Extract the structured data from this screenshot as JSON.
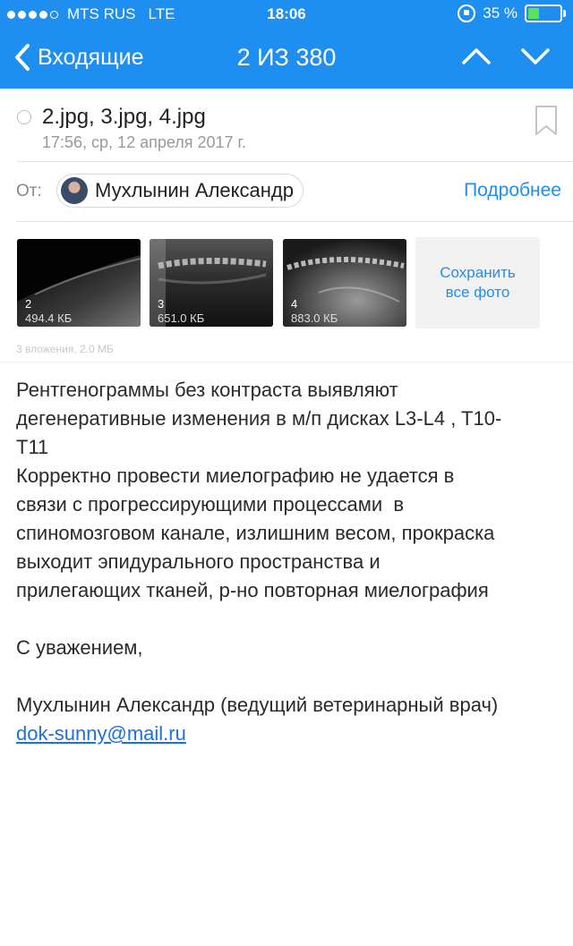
{
  "status_bar": {
    "carrier": "MTS RUS",
    "network": "LTE",
    "time": "18:06",
    "battery_percent": "35 %",
    "battery_level": 0.35
  },
  "nav": {
    "back_label": "Входящие",
    "counter": "2 ИЗ 380"
  },
  "message": {
    "subject": "2.jpg, 3.jpg, 4.jpg",
    "date": "17:56, ср, 12 апреля 2017 г.",
    "from_label": "От:",
    "sender": "Мухлынин Александр",
    "details_label": "Подробнее"
  },
  "attachments": {
    "items": [
      {
        "num": "2",
        "size": "494.4 КБ"
      },
      {
        "num": "3",
        "size": "651.0 КБ"
      },
      {
        "num": "4",
        "size": "883.0 КБ"
      }
    ],
    "save_all_line1": "Сохранить",
    "save_all_line2": "все фото",
    "summary": "3 вложения, 2.0 МБ"
  },
  "body": {
    "line1": "Рентгенограммы без контраста выявляют",
    "line2": "дегенеративные изменения в м/п дисках L3-L4 , T10-",
    "line3": "T11",
    "line4": "Корректно провести миелографию не удается в",
    "line5": "связи с прогрессирующими процессами  в",
    "line6": "спиномозговом канале, излишним весом, прокраска",
    "line7": "выходит эпидурального пространства и",
    "line8": "прилегающих тканей, р-но повторная миелография",
    "greeting": "С уважением,",
    "signature": "Мухлынин Александр (ведущий ветеринарный врач)",
    "email": "dok-sunny@mail.ru"
  },
  "colors": {
    "accent": "#1e8ef0",
    "battery_fill": "#5ee05a"
  }
}
